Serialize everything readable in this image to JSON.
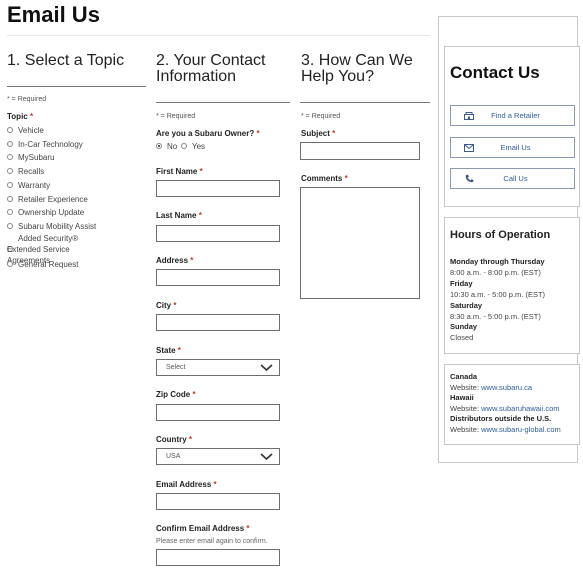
{
  "page": {
    "title": "Email Us"
  },
  "topics": {
    "heading": "1. Select a Topic",
    "required_note": "* = Required",
    "label": "Topic",
    "star": "*",
    "options": [
      "Vehicle",
      "In-Car Technology",
      "MySubaru",
      "Recalls",
      "Warranty",
      "Retailer Experience",
      "Ownership Update",
      "Subaru Mobility Assist",
      "Added Security® Extended Service Agreements",
      "General Request"
    ]
  },
  "contact_info": {
    "heading_line1": "2. Your Contact",
    "heading_line2": "Information",
    "required_note": "* = Required",
    "owner_question": "Are you a Subaru Owner?",
    "owner_no": "No",
    "owner_yes": "Yes",
    "owner_selected": "No",
    "first_name_label": "First Name",
    "last_name_label": "Last Name",
    "address_label": "Address",
    "city_label": "City",
    "state_label": "State",
    "state_value": "Select",
    "zip_label": "Zip Code",
    "country_label": "Country",
    "country_value": "USA",
    "email_label": "Email Address",
    "confirm_email_label": "Confirm Email Address",
    "confirm_email_hint": "Please enter email again to confirm.",
    "star": "*"
  },
  "help": {
    "heading_line1": "3. How Can We",
    "heading_line2": "Help You?",
    "required_note": "* = Required",
    "subject_label": "Subject",
    "comments_label": "Comments",
    "star": "*"
  },
  "sidebar": {
    "contact_heading": "Contact Us",
    "buttons": [
      {
        "label": "Find a Retailer",
        "icon": "retailer-icon"
      },
      {
        "label": "Email Us",
        "icon": "envelope-icon"
      },
      {
        "label": "Call Us",
        "icon": "phone-icon"
      }
    ],
    "hours_heading": "Hours of Operation",
    "hours": [
      {
        "day": "Monday through Thursday",
        "time": "8:00 a.m. - 8:00 p.m. (EST)"
      },
      {
        "day": "Friday",
        "time": "10:30 a.m. - 5:00 p.m. (EST)"
      },
      {
        "day": "Saturday",
        "time": "8:30 a.m. - 5:00 p.m. (EST)"
      },
      {
        "day": "Sunday",
        "time": "Closed"
      }
    ],
    "website_prefix": "Website:",
    "distributors": [
      {
        "name": "Canada",
        "url": "www.subaru.ca"
      },
      {
        "name": "Hawaii",
        "url": "www.subaruhawaii.com"
      },
      {
        "name": "Distributors outside the U.S.",
        "url": "www.subaru-global.com"
      }
    ]
  }
}
